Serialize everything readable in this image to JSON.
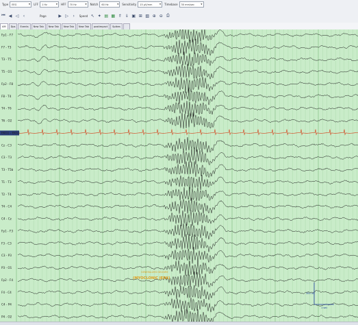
{
  "toolbar": {
    "type_label": "Type",
    "type_value": "EEG",
    "lff_label": "LFF",
    "lff_value": "1 Hz",
    "hff_label": "HFF",
    "hff_value": "70 Hz",
    "notch_label": "Notch",
    "notch_value": "60 Hz",
    "sensitivity_label": "Sensitivity",
    "sensitivity_value": "15 µV/mm",
    "timebase_label": "Timebase",
    "timebase_value": "30 mm/sec",
    "page_label": "Page",
    "speed_label": "Speed"
  },
  "tabs": [
    "AM",
    "Dps",
    "Events",
    "New Tab",
    "New Tab",
    "New Tab",
    "New Tab",
    "postimpact",
    "Spikes"
  ],
  "channels": [
    "Fp1 - F7",
    "F7 - T3",
    "T3 - T5",
    "T5 - O1",
    "Fp2 - F8",
    "F8 - T4",
    "T4 - T6",
    "T6 - O2",
    "EKG1 - EKG2",
    "Cz - C3",
    "C3 - T3",
    "T3 - T5b",
    "T1 - T3",
    "T2 - T4",
    "T4 - C4",
    "C4 - Cz",
    "Fp1 - F3",
    "F3 - C3",
    "C3 - P3",
    "P3 - O1",
    "Fp2 - F4",
    "F4 - C4",
    "C4 - P4",
    "P4 - O2"
  ],
  "annotation": {
    "line1": "GENERALIZED SEIZURE",
    "line2": "(MYOCLONIC JERK)"
  },
  "scale": {
    "amplitude_label": "300 uV",
    "time_label": "1 sec"
  },
  "colors": {
    "background": "#c9ecc9",
    "trace": "#1a1a1a",
    "ekg_trace": "#d4502a",
    "annotation": "#e0a020",
    "scale_bar": "#1a3a9a"
  }
}
